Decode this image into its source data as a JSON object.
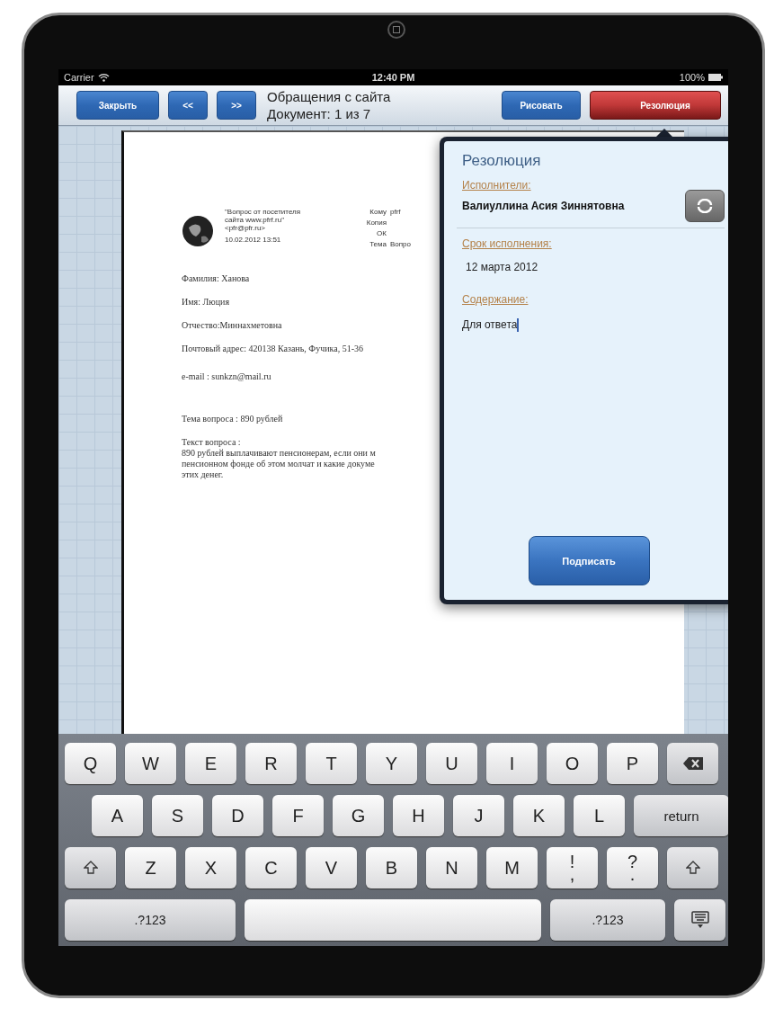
{
  "status_bar": {
    "carrier": "Carrier",
    "time": "12:40 PM",
    "battery": "100%"
  },
  "toolbar": {
    "left_buttons": [
      {
        "label": "Закрыть",
        "kind": "wide"
      },
      {
        "label": "<<",
        "kind": "narrow"
      },
      {
        "label": ">>",
        "kind": "narrow"
      }
    ],
    "title": "Обращения с сайта",
    "subtitle": "Документ: 1 из 7",
    "right_buttons": [
      {
        "label": "Рисовать",
        "selected": false
      },
      {
        "label": "Резолюция",
        "selected": true
      }
    ]
  },
  "document": {
    "sender": [
      "\"Вопрос от посетителя",
      "сайта www.pfrf.ru\"",
      "<pfr@pfr.ru>"
    ],
    "date": "10.02.2012 13:51",
    "fields": [
      {
        "label": "Кому",
        "value": "pfrf"
      },
      {
        "label": "Копия"
      },
      {
        "label": "ОК"
      },
      {
        "label": "Тема",
        "value": "Вопро"
      }
    ],
    "paragraphs": [
      "Фамилия: Ханова",
      "Имя: Люция",
      "Отчество:Миннахметовна",
      "Почтовый адрес: 420138 Казань, Фучика, 51-36",
      "e-mail : sunkzn@mail.ru",
      "Тема вопроса : 890 рублей"
    ],
    "question_label": "Текст вопроса :",
    "question_lines": [
      "890 рублей выплачивают пенсионерам, если они м",
      "пенсионном фонде об этом молчат и какие докуме",
      "этих денег."
    ]
  },
  "popover": {
    "title": "Резолюция",
    "assignees_label": "Исполнители:",
    "assignee": "Валиуллина Асия Зиннятовна",
    "deadline_label": "Срок исполнения:",
    "deadline": "12 марта 2012",
    "content_label": "Содержание:",
    "content": "Для ответа",
    "sign_button": "Подписать"
  },
  "keyboard": [
    [
      {
        "kind": "letter",
        "label": "Q"
      },
      {
        "kind": "letter",
        "label": "W"
      },
      {
        "kind": "letter",
        "label": "E"
      },
      {
        "kind": "letter",
        "label": "R"
      },
      {
        "kind": "letter",
        "label": "T"
      },
      {
        "kind": "letter",
        "label": "Y"
      },
      {
        "kind": "letter",
        "label": "U"
      },
      {
        "kind": "letter",
        "label": "I"
      },
      {
        "kind": "letter",
        "label": "O"
      },
      {
        "kind": "letter",
        "label": "P"
      },
      {
        "kind": "backspace"
      }
    ],
    [
      {
        "kind": "letter",
        "label": "A"
      },
      {
        "kind": "letter",
        "label": "S"
      },
      {
        "kind": "letter",
        "label": "D"
      },
      {
        "kind": "letter",
        "label": "F"
      },
      {
        "kind": "letter",
        "label": "G"
      },
      {
        "kind": "letter",
        "label": "H"
      },
      {
        "kind": "letter",
        "label": "J"
      },
      {
        "kind": "letter",
        "label": "K"
      },
      {
        "kind": "letter",
        "label": "L"
      },
      {
        "kind": "return",
        "label": "return"
      }
    ],
    [
      {
        "kind": "shift"
      },
      {
        "kind": "letter",
        "label": "Z"
      },
      {
        "kind": "letter",
        "label": "X"
      },
      {
        "kind": "letter",
        "label": "C"
      },
      {
        "kind": "letter",
        "label": "V"
      },
      {
        "kind": "letter",
        "label": "B"
      },
      {
        "kind": "letter",
        "label": "N"
      },
      {
        "kind": "letter",
        "label": "M"
      },
      {
        "kind": "dual",
        "label": "!",
        "sublabel": ","
      },
      {
        "kind": "dual",
        "label": "?",
        "sublabel": "."
      },
      {
        "kind": "shift"
      }
    ],
    [
      {
        "kind": "mode",
        "label": ".?123"
      },
      {
        "kind": "space"
      },
      {
        "kind": "mode",
        "label": ".?123"
      },
      {
        "kind": "hide"
      }
    ]
  ]
}
